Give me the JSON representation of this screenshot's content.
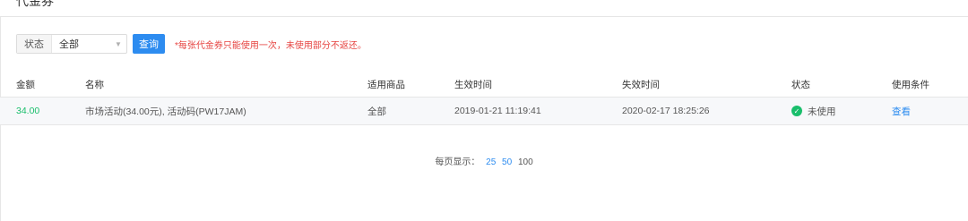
{
  "page": {
    "title": "代金券"
  },
  "filter": {
    "status_label": "状态",
    "status_value": "全部",
    "query_label": "查询",
    "note": "*每张代金券只能使用一次，未使用部分不返还。"
  },
  "table": {
    "columns": [
      "金额",
      "名称",
      "适用商品",
      "生效时间",
      "失效时间",
      "状态",
      "使用条件"
    ],
    "rows": [
      {
        "amount": "34.00",
        "name": "市场活动(34.00元), 活动码(PW17JAM)",
        "scope": "全部",
        "start": "2019-01-21 11:19:41",
        "end": "2020-02-17 18:25:26",
        "status": "未使用",
        "action": "查看"
      }
    ]
  },
  "pagination": {
    "label": "每页显示：",
    "sizes": [
      "25",
      "50",
      "100"
    ],
    "active": "25"
  },
  "colors": {
    "accent": "#2d8cf0",
    "success": "#19be6b",
    "warning_text": "#e64340"
  }
}
